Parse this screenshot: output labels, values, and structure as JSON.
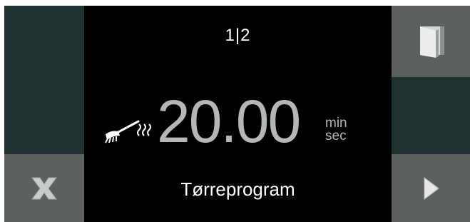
{
  "display": {
    "step_indicator": "1|2",
    "time_value": "20.00",
    "time_unit_top": "min",
    "time_unit_bottom": "sec",
    "program_name": "Tørreprogram"
  },
  "buttons": {
    "cancel": {
      "icon": "close-icon"
    },
    "door": {
      "icon": "door-icon"
    },
    "next": {
      "icon": "play-arrow-icon"
    }
  },
  "colors": {
    "panel_dark_teal": "#203131",
    "button_gray": "#5c605f",
    "center_black": "#000000",
    "time_text": "#b4b7b8",
    "label_text": "#ffffff"
  }
}
